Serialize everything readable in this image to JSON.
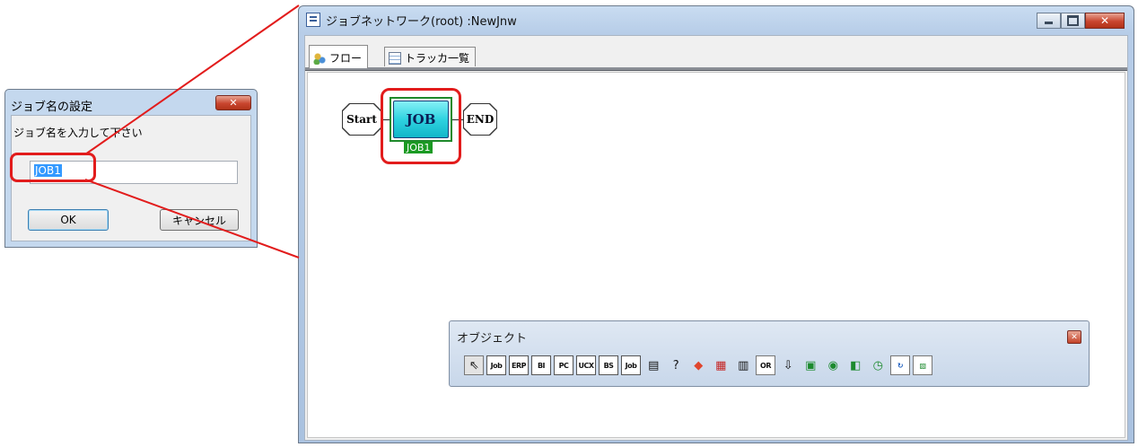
{
  "main_window": {
    "title": "ジョブネットワーク(root) :NewJnw",
    "buttons": {
      "minimize": "–",
      "maximize": "□",
      "close": "✕"
    },
    "tabs": [
      {
        "label": "フロー",
        "icon": "flow-icon",
        "active": true
      },
      {
        "label": "トラッカ一覧",
        "icon": "tracker-list-icon",
        "active": false
      }
    ]
  },
  "flow": {
    "start_label": "Start",
    "job_label": "JOB",
    "job_name": "JOB1",
    "end_label": "END"
  },
  "palette": {
    "title": "オブジェクト",
    "close": "✕",
    "tools": [
      {
        "name": "pointer-tool-icon",
        "text": "⇖"
      },
      {
        "name": "job-tool-icon",
        "text": "Job"
      },
      {
        "name": "erp-tool-icon",
        "text": "ERP"
      },
      {
        "name": "bi-tool-icon",
        "text": "BI"
      },
      {
        "name": "pc-tool-icon",
        "text": "PC"
      },
      {
        "name": "ucx-tool-icon",
        "text": "UCX"
      },
      {
        "name": "bs-tool-icon",
        "text": "BS"
      },
      {
        "name": "job-wait-tool-icon",
        "text": "Job"
      },
      {
        "name": "document-tool-icon",
        "text": "▤"
      },
      {
        "name": "condition-tool-icon",
        "text": "?"
      },
      {
        "name": "branch-tool-icon",
        "text": "◆"
      },
      {
        "name": "calendar-tool-icon",
        "text": "▦"
      },
      {
        "name": "parallel-tool-icon",
        "text": "▥"
      },
      {
        "name": "or-tool-icon",
        "text": "OR"
      },
      {
        "name": "arrow-down-tool-icon",
        "text": "⇩"
      },
      {
        "name": "wait-job-tool-icon",
        "text": "▣"
      },
      {
        "name": "wait-jnw-tool-icon",
        "text": "◉"
      },
      {
        "name": "wait-file-tool-icon",
        "text": "◧"
      },
      {
        "name": "wait-time-tool-icon",
        "text": "◷"
      },
      {
        "name": "event-send-tool-icon",
        "text": "↻"
      },
      {
        "name": "event-receive-tool-icon",
        "text": "▧"
      }
    ]
  },
  "dialog": {
    "title": "ジョブ名の設定",
    "close": "✕",
    "prompt": "ジョブ名を入力して下さい",
    "input_value": "JOB1",
    "ok_label": "OK",
    "cancel_label": "キャンセル"
  },
  "colors": {
    "highlight": "#e21c1c",
    "job_fill": "#2fd3e0",
    "job_label_bg": "#1b9a23",
    "titlebar": "#c4d8ee"
  }
}
